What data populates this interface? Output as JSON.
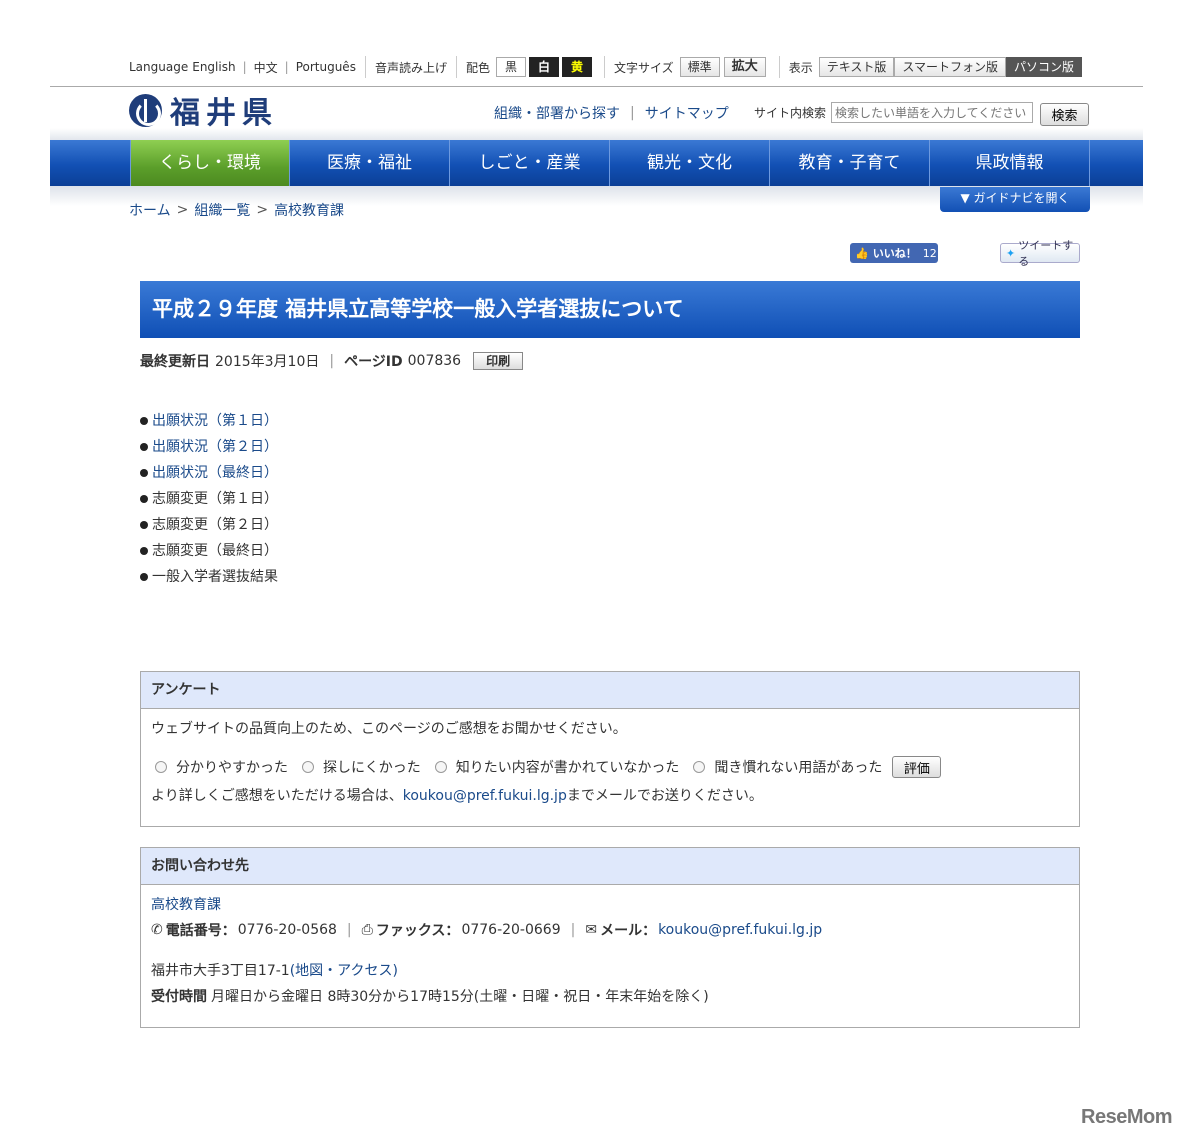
{
  "utility": {
    "language_label": "Language",
    "languages": [
      "English",
      "中文",
      "Português"
    ],
    "read_aloud": "音声読み上げ",
    "color_label": "配色",
    "colors": [
      "黒",
      "白",
      "黄"
    ],
    "text_size_label": "文字サイズ",
    "size_standard": "標準",
    "size_large": "拡大",
    "display_label": "表示",
    "display_modes": [
      "テキスト版",
      "スマートフォン版",
      "パソコン版"
    ]
  },
  "header": {
    "logo_text": "福井県",
    "links": [
      "組織・部署から探す",
      "サイトマップ"
    ],
    "search_label": "サイト内検索",
    "search_placeholder": "検索したい単語を入力してください",
    "search_button": "検索"
  },
  "nav": {
    "items": [
      "くらし・環境",
      "医療・福祉",
      "しごと・産業",
      "観光・文化",
      "教育・子育て",
      "県政情報"
    ],
    "active_index": 0
  },
  "breadcrumb": [
    "ホーム",
    "組織一覧",
    "高校教育課"
  ],
  "guide_button": "▼ ガイドナビを開く",
  "social": {
    "like_label": "いいね！",
    "like_count": "12",
    "tweet_label": "ツイートする"
  },
  "page": {
    "title": "平成２９年度 福井県立高等学校一般入学者選抜について",
    "updated_label": "最終更新日",
    "updated_value": "2015年3月10日",
    "pageid_label": "ページID",
    "pageid_value": "007836",
    "print_button": "印刷"
  },
  "links": [
    {
      "text": "出願状況（第１日）",
      "is_link": true
    },
    {
      "text": "出願状況（第２日）",
      "is_link": true
    },
    {
      "text": "出願状況（最終日）",
      "is_link": true
    },
    {
      "text": "志願変更（第１日）",
      "is_link": false
    },
    {
      "text": "志願変更（第２日）",
      "is_link": false
    },
    {
      "text": "志願変更（最終日）",
      "is_link": false
    },
    {
      "text": "一般入学者選抜結果",
      "is_link": false
    }
  ],
  "survey": {
    "heading": "アンケート",
    "intro": "ウェブサイトの品質向上のため、このページのご感想をお聞かせください。",
    "options": [
      "分かりやすかった",
      "探しにくかった",
      "知りたい内容が書かれていなかった",
      "聞き慣れない用語があった"
    ],
    "submit": "評価",
    "more_prefix": "より詳しくご感想をいただける場合は、",
    "email": "koukou@pref.fukui.lg.jp",
    "more_suffix": "までメールでお送りください。"
  },
  "contact": {
    "heading": "お問い合わせ先",
    "dept": "高校教育課",
    "tel_label": "電話番号：",
    "tel": "0776-20-0568",
    "fax_label": "ファックス：",
    "fax": "0776-20-0669",
    "mail_label": "メール：",
    "mail": "koukou@pref.fukui.lg.jp",
    "address": "福井市大手3丁目17-1",
    "map_link": "(地図・アクセス)",
    "hours_label": "受付時間",
    "hours": "月曜日から金曜日 8時30分から17時15分(土曜・日曜・祝日・年末年始を除く)"
  },
  "watermark": "ReseMom"
}
